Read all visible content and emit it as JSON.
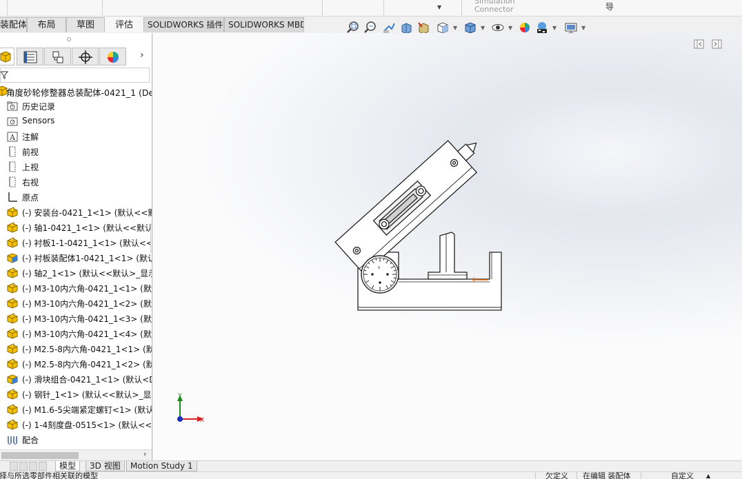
{
  "ribbon": {
    "frag_connector_1": "Simulation",
    "frag_connector_2": "Connector",
    "frag_daoh": "导"
  },
  "command_tabs": [
    {
      "label": "装配体"
    },
    {
      "label": "布局"
    },
    {
      "label": "草图"
    },
    {
      "label": "评估"
    },
    {
      "label": "SOLIDWORKS 插件"
    },
    {
      "label": "SOLIDWORKS MBD"
    }
  ],
  "heads_up_toolbar": [
    "zoom-to-fit-icon",
    "zoom-to-area-icon",
    "previous-view-icon",
    "section-view-icon",
    "dynamic-annotation-icon",
    "view-orientation-icon",
    "display-style-icon",
    "hide-show-items-icon",
    "edit-appearance-icon",
    "apply-scene-icon",
    "view-settings-icon"
  ],
  "feature_manager": {
    "panel_tabs": [
      "featuremanager-tree-icon",
      "property-manager-icon",
      "configuration-manager-icon",
      "dimxpert-manager-icon",
      "display-manager-icon"
    ],
    "root": {
      "label": "角度砂轮修整器总装配体-0421_1  (Def"
    },
    "items": [
      {
        "label": "历史记录",
        "icon": "history-folder-icon"
      },
      {
        "label": "Sensors",
        "icon": "sensors-icon"
      },
      {
        "label": "注解",
        "icon": "annotations-icon"
      },
      {
        "label": "前视",
        "icon": "plane-icon"
      },
      {
        "label": "上视",
        "icon": "plane-icon"
      },
      {
        "label": "右视",
        "icon": "plane-icon"
      },
      {
        "label": "原点",
        "icon": "origin-icon"
      },
      {
        "label": "(-) 安装台-0421_1<1> (默认<<默",
        "icon": "part-icon"
      },
      {
        "label": "(-) 轴1-0421_1<1> (默认<<默认>",
        "icon": "part-icon"
      },
      {
        "label": "(-) 衬板1-1-0421_1<1> (默认<<默",
        "icon": "part-icon"
      },
      {
        "label": "(-) 衬板装配体1-0421_1<1> (默认",
        "icon": "subassembly-icon"
      },
      {
        "label": "(-) 轴2_1<1> (默认<<默认>_显示",
        "icon": "part-icon"
      },
      {
        "label": "(-) M3-10内六角-0421_1<1> (默认",
        "icon": "part-icon"
      },
      {
        "label": "(-) M3-10内六角-0421_1<2> (默认",
        "icon": "part-icon"
      },
      {
        "label": "(-) M3-10内六角-0421_1<3> (默认",
        "icon": "part-icon"
      },
      {
        "label": "(-) M3-10内六角-0421_1<4> (默认",
        "icon": "part-icon"
      },
      {
        "label": "(-) M2.5-8内六角-0421_1<1> (默认",
        "icon": "part-icon"
      },
      {
        "label": "(-) M2.5-8内六角-0421_1<2> (默认",
        "icon": "part-icon"
      },
      {
        "label": "(-) 滑块组合-0421_1<1> (默认<D",
        "icon": "subassembly-icon"
      },
      {
        "label": "(-) 钢针_1<1> (默认<<默认>_显示",
        "icon": "part-icon"
      },
      {
        "label": "(-) M1.6-5尖端紧定螺钉<1> (默认",
        "icon": "part-icon"
      },
      {
        "label": "(-) 1-4刻度盘-0515<1> (默认<<默",
        "icon": "part-icon"
      },
      {
        "label": "配合",
        "icon": "mates-icon"
      }
    ]
  },
  "triad": {
    "x_label": "X",
    "y_label": "Y"
  },
  "bottom_tabs": [
    {
      "label": "模型"
    },
    {
      "label": "3D 视图"
    },
    {
      "label": "Motion Study 1"
    }
  ],
  "status_bar": {
    "hint": "选择与所选零部件相关联的模型",
    "state_1": "欠定义",
    "state_2": "在编辑 装配体",
    "state_3": "自定义"
  },
  "colors": {
    "part_yellow": "#f5c000",
    "subassembly_blue": "#3a7fd0",
    "triad_y": "#1a8a1a",
    "triad_x": "#d42020",
    "triad_origin": "#1a30c0",
    "sketch_orange": "#f07010"
  }
}
